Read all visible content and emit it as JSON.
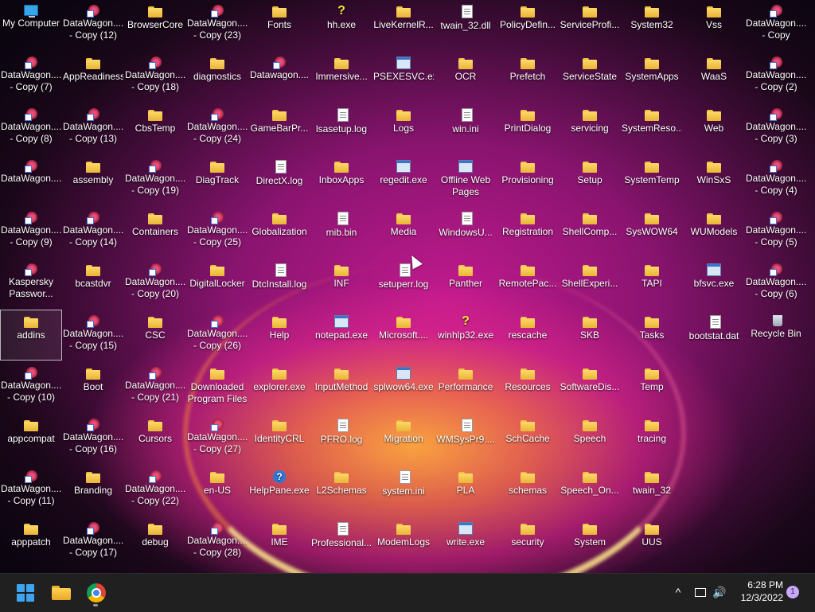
{
  "desktop": {
    "icons": [
      {
        "label": "My Computer",
        "icon": "computer-icon"
      },
      {
        "label": "DataWagon....\n- Copy (12)",
        "icon": "shortcut-icon"
      },
      {
        "label": "BrowserCore",
        "icon": "folder-icon"
      },
      {
        "label": "DataWagon....\n- Copy (23)",
        "icon": "shortcut-icon"
      },
      {
        "label": "Fonts",
        "icon": "fonts-folder-icon"
      },
      {
        "label": "hh.exe",
        "icon": "help-exe-icon"
      },
      {
        "label": "LiveKernelR...",
        "icon": "folder-icon"
      },
      {
        "label": "twain_32.dll",
        "icon": "file-icon"
      },
      {
        "label": "PolicyDefin...",
        "icon": "folder-icon"
      },
      {
        "label": "ServiceProfi...",
        "icon": "folder-icon"
      },
      {
        "label": "System32",
        "icon": "folder-icon"
      },
      {
        "label": "Vss",
        "icon": "folder-icon"
      },
      {
        "label": "DataWagon....\n- Copy",
        "icon": "shortcut-icon"
      },
      {
        "label": "DataWagon....\n- Copy (7)",
        "icon": "shortcut-icon"
      },
      {
        "label": "AppReadiness",
        "icon": "folder-icon"
      },
      {
        "label": "DataWagon....\n- Copy (18)",
        "icon": "shortcut-icon"
      },
      {
        "label": "diagnostics",
        "icon": "folder-icon"
      },
      {
        "label": "Datawagon....",
        "icon": "datawagon-icon"
      },
      {
        "label": "Immersive...",
        "icon": "folder-icon"
      },
      {
        "label": "PSEXESVC.exe",
        "icon": "exe-icon"
      },
      {
        "label": "OCR",
        "icon": "folder-icon"
      },
      {
        "label": "Prefetch",
        "icon": "folder-icon"
      },
      {
        "label": "ServiceState",
        "icon": "folder-icon"
      },
      {
        "label": "SystemApps",
        "icon": "folder-icon"
      },
      {
        "label": "WaaS",
        "icon": "folder-icon"
      },
      {
        "label": "DataWagon....\n- Copy (2)",
        "icon": "shortcut-icon"
      },
      {
        "label": "DataWagon....\n- Copy (8)",
        "icon": "shortcut-icon"
      },
      {
        "label": "DataWagon....\n- Copy (13)",
        "icon": "shortcut-icon"
      },
      {
        "label": "CbsTemp",
        "icon": "folder-icon"
      },
      {
        "label": "DataWagon....\n- Copy (24)",
        "icon": "shortcut-icon"
      },
      {
        "label": "GameBarPr...",
        "icon": "folder-icon"
      },
      {
        "label": "lsasetup.log",
        "icon": "file-icon"
      },
      {
        "label": "Logs",
        "icon": "folder-icon"
      },
      {
        "label": "win.ini",
        "icon": "file-icon"
      },
      {
        "label": "PrintDialog",
        "icon": "folder-icon"
      },
      {
        "label": "servicing",
        "icon": "folder-icon"
      },
      {
        "label": "SystemReso...",
        "icon": "folder-icon"
      },
      {
        "label": "Web",
        "icon": "folder-icon"
      },
      {
        "label": "DataWagon....\n- Copy (3)",
        "icon": "shortcut-icon"
      },
      {
        "label": "DataWagon....",
        "icon": "shortcut-icon"
      },
      {
        "label": "assembly",
        "icon": "folder-icon"
      },
      {
        "label": "DataWagon....\n- Copy (19)",
        "icon": "shortcut-icon"
      },
      {
        "label": "DiagTrack",
        "icon": "folder-icon"
      },
      {
        "label": "DirectX.log",
        "icon": "file-icon"
      },
      {
        "label": "InboxApps",
        "icon": "folder-icon"
      },
      {
        "label": "regedit.exe",
        "icon": "exe-icon"
      },
      {
        "label": "Offline Web\nPages",
        "icon": "exe-icon"
      },
      {
        "label": "Provisioning",
        "icon": "folder-icon"
      },
      {
        "label": "Setup",
        "icon": "folder-icon"
      },
      {
        "label": "SystemTemp",
        "icon": "folder-icon"
      },
      {
        "label": "WinSxS",
        "icon": "folder-icon"
      },
      {
        "label": "DataWagon....\n- Copy (4)",
        "icon": "shortcut-icon"
      },
      {
        "label": "DataWagon....\n- Copy (9)",
        "icon": "shortcut-icon"
      },
      {
        "label": "DataWagon....\n- Copy (14)",
        "icon": "shortcut-icon"
      },
      {
        "label": "Containers",
        "icon": "folder-icon"
      },
      {
        "label": "DataWagon....\n- Copy (25)",
        "icon": "shortcut-icon"
      },
      {
        "label": "Globalization",
        "icon": "folder-icon"
      },
      {
        "label": "mib.bin",
        "icon": "file-icon"
      },
      {
        "label": "Media",
        "icon": "folder-icon"
      },
      {
        "label": "WindowsU...",
        "icon": "file-icon"
      },
      {
        "label": "Registration",
        "icon": "folder-icon"
      },
      {
        "label": "ShellComp...",
        "icon": "folder-icon"
      },
      {
        "label": "SysWOW64",
        "icon": "folder-icon"
      },
      {
        "label": "WUModels",
        "icon": "folder-icon"
      },
      {
        "label": "DataWagon....\n- Copy (5)",
        "icon": "shortcut-icon"
      },
      {
        "label": "Kaspersky\nPasswor...",
        "icon": "kaspersky-icon"
      },
      {
        "label": "bcastdvr",
        "icon": "folder-icon"
      },
      {
        "label": "DataWagon....\n- Copy (20)",
        "icon": "shortcut-icon"
      },
      {
        "label": "DigitalLocker",
        "icon": "folder-icon"
      },
      {
        "label": "DtcInstall.log",
        "icon": "file-icon"
      },
      {
        "label": "INF",
        "icon": "folder-icon"
      },
      {
        "label": "setuperr.log",
        "icon": "file-icon"
      },
      {
        "label": "Panther",
        "icon": "folder-icon"
      },
      {
        "label": "RemotePac...",
        "icon": "folder-icon"
      },
      {
        "label": "ShellExperi...",
        "icon": "folder-icon"
      },
      {
        "label": "TAPI",
        "icon": "folder-icon"
      },
      {
        "label": "bfsvc.exe",
        "icon": "exe-icon"
      },
      {
        "label": "DataWagon....\n- Copy (6)",
        "icon": "shortcut-icon"
      },
      {
        "label": "addins",
        "icon": "folder-icon"
      },
      {
        "label": "DataWagon....\n- Copy (15)",
        "icon": "shortcut-icon"
      },
      {
        "label": "CSC",
        "icon": "folder-icon"
      },
      {
        "label": "DataWagon....\n- Copy (26)",
        "icon": "shortcut-icon"
      },
      {
        "label": "Help",
        "icon": "folder-icon"
      },
      {
        "label": "notepad.exe",
        "icon": "exe-icon"
      },
      {
        "label": "Microsoft....",
        "icon": "folder-icon"
      },
      {
        "label": "winhlp32.exe",
        "icon": "help-exe-icon"
      },
      {
        "label": "rescache",
        "icon": "folder-icon"
      },
      {
        "label": "SKB",
        "icon": "folder-icon"
      },
      {
        "label": "Tasks",
        "icon": "folder-icon"
      },
      {
        "label": "bootstat.dat",
        "icon": "file-icon"
      },
      {
        "label": "Recycle Bin",
        "icon": "recycle-bin-icon"
      },
      {
        "label": "DataWagon....\n- Copy (10)",
        "icon": "shortcut-icon"
      },
      {
        "label": "Boot",
        "icon": "folder-icon"
      },
      {
        "label": "DataWagon....\n- Copy (21)",
        "icon": "shortcut-icon"
      },
      {
        "label": "Downloaded\nProgram Files",
        "icon": "folder-icon"
      },
      {
        "label": "explorer.exe",
        "icon": "folder-icon"
      },
      {
        "label": "InputMethod",
        "icon": "folder-icon"
      },
      {
        "label": "splwow64.exe",
        "icon": "exe-icon"
      },
      {
        "label": "Performance",
        "icon": "folder-icon"
      },
      {
        "label": "Resources",
        "icon": "folder-icon"
      },
      {
        "label": "SoftwareDis...",
        "icon": "folder-icon"
      },
      {
        "label": "Temp",
        "icon": "folder-icon"
      },
      {
        "label": "appcompat",
        "icon": "folder-icon"
      },
      {
        "label": "DataWagon....\n- Copy (16)",
        "icon": "shortcut-icon"
      },
      {
        "label": "Cursors",
        "icon": "folder-icon"
      },
      {
        "label": "DataWagon....\n- Copy (27)",
        "icon": "shortcut-icon"
      },
      {
        "label": "IdentityCRL",
        "icon": "folder-icon"
      },
      {
        "label": "PFRO.log",
        "icon": "file-icon"
      },
      {
        "label": "Migration",
        "icon": "folder-icon"
      },
      {
        "label": "WMSysPr9....",
        "icon": "file-icon"
      },
      {
        "label": "SchCache",
        "icon": "folder-icon"
      },
      {
        "label": "Speech",
        "icon": "folder-icon"
      },
      {
        "label": "tracing",
        "icon": "folder-icon"
      },
      {
        "label": "DataWagon....\n- Copy (11)",
        "icon": "shortcut-icon"
      },
      {
        "label": "Branding",
        "icon": "folder-icon"
      },
      {
        "label": "DataWagon....\n- Copy (22)",
        "icon": "shortcut-icon"
      },
      {
        "label": "en-US",
        "icon": "folder-icon"
      },
      {
        "label": "HelpPane.exe",
        "icon": "help-icon"
      },
      {
        "label": "L2Schemas",
        "icon": "folder-icon"
      },
      {
        "label": "system.ini",
        "icon": "file-icon"
      },
      {
        "label": "PLA",
        "icon": "folder-icon"
      },
      {
        "label": "schemas",
        "icon": "folder-icon"
      },
      {
        "label": "Speech_On...",
        "icon": "folder-icon"
      },
      {
        "label": "twain_32",
        "icon": "folder-icon"
      },
      {
        "label": "apppatch",
        "icon": "folder-icon"
      },
      {
        "label": "DataWagon....\n- Copy (17)",
        "icon": "shortcut-icon"
      },
      {
        "label": "debug",
        "icon": "folder-icon"
      },
      {
        "label": "DataWagon....\n- Copy (28)",
        "icon": "shortcut-icon"
      },
      {
        "label": "IME",
        "icon": "folder-icon"
      },
      {
        "label": "Professional...",
        "icon": "file-icon"
      },
      {
        "label": "ModemLogs",
        "icon": "folder-icon"
      },
      {
        "label": "write.exe",
        "icon": "exe-icon"
      },
      {
        "label": "security",
        "icon": "folder-icon"
      },
      {
        "label": "System",
        "icon": "folder-icon"
      },
      {
        "label": "UUS",
        "icon": "folder-icon"
      }
    ]
  },
  "taskbar": {
    "start": "start-icon",
    "pinned": [
      "file-explorer-icon",
      "chrome-icon"
    ],
    "tray_chevron": "^",
    "volume_glyph": "🔊",
    "time": "6:28 PM",
    "date": "12/3/2022",
    "notification_count": "1"
  }
}
